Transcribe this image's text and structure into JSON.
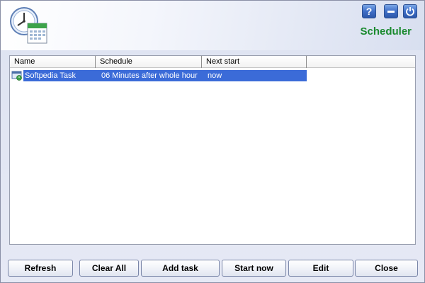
{
  "app": {
    "title": "Scheduler"
  },
  "window_controls": {
    "help_label": "?",
    "minimize_label": "",
    "power_label": ""
  },
  "table": {
    "columns": [
      "Name",
      "Schedule",
      "Next start"
    ],
    "rows": [
      {
        "name": "Softpedia Task",
        "schedule": "06 Minutes after whole hour",
        "next_start": "now"
      }
    ]
  },
  "buttons": {
    "refresh": "Refresh",
    "clear_all": "Clear All",
    "add_task": "Add task",
    "start_now": "Start now",
    "edit": "Edit",
    "close": "Close"
  },
  "colors": {
    "title": "#1a8a2e",
    "selection": "#3b6bd8",
    "control_button": "#3f6fc8"
  }
}
